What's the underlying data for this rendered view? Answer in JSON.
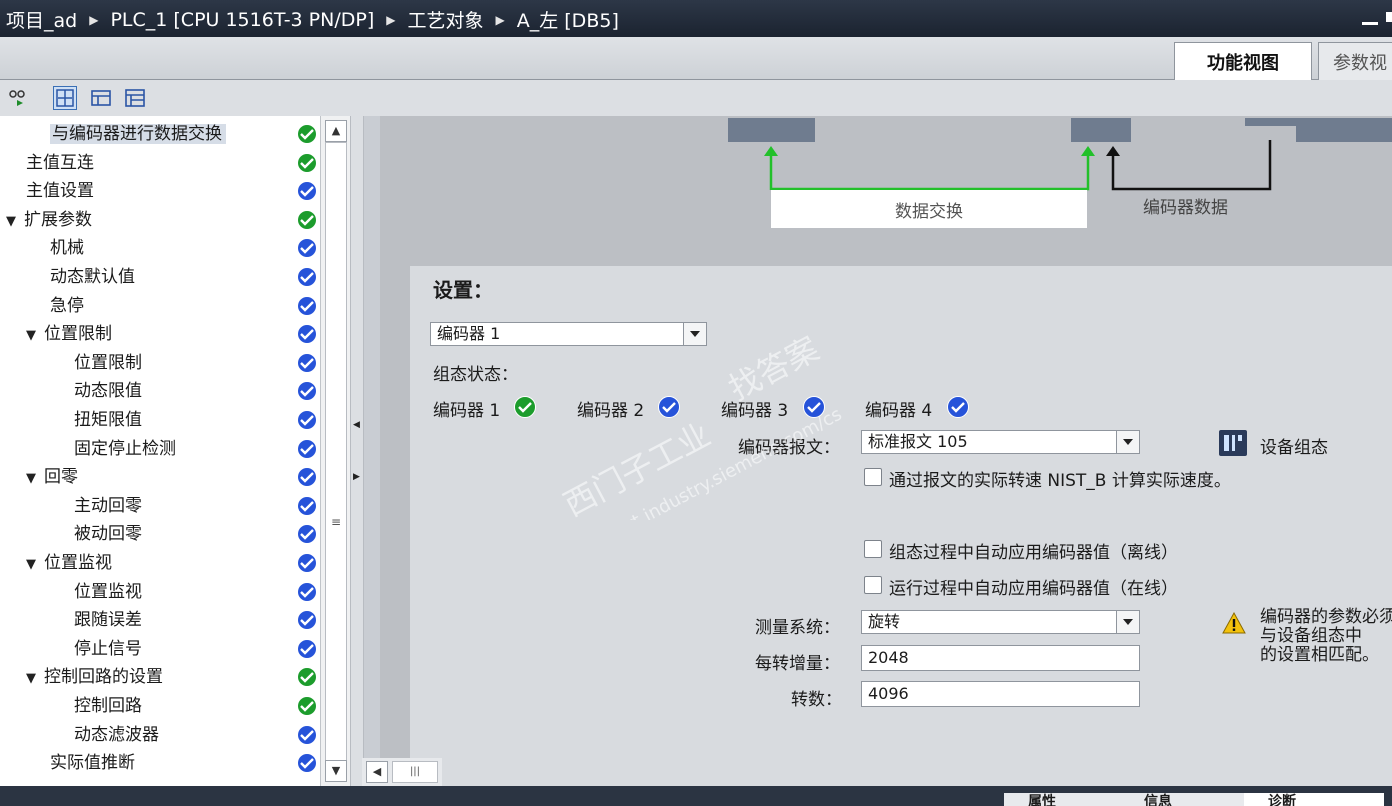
{
  "titlebar": {
    "crumbs": [
      "项目_ad",
      "PLC_1 [CPU 1516T-3 PN/DP]",
      "工艺对象",
      "A_左 [DB5]"
    ]
  },
  "view_tabs": {
    "function_view": "功能视图",
    "parameter_view": "参数视"
  },
  "nav": {
    "items": [
      {
        "label": "与编码器进行数据交换",
        "level": 2,
        "expander": "",
        "status": "green",
        "selected": true
      },
      {
        "label": "主值互连",
        "level": 1,
        "expander": "",
        "status": "green"
      },
      {
        "label": "主值设置",
        "level": 1,
        "expander": "",
        "status": "blue"
      },
      {
        "label": "扩展参数",
        "level": 0,
        "expander": "▼",
        "status": "green"
      },
      {
        "label": "机械",
        "level": 2,
        "expander": "",
        "status": "blue"
      },
      {
        "label": "动态默认值",
        "level": 2,
        "expander": "",
        "status": "blue"
      },
      {
        "label": "急停",
        "level": 2,
        "expander": "",
        "status": "blue"
      },
      {
        "label": "位置限制",
        "level": 1,
        "expander": "▼",
        "status": "blue"
      },
      {
        "label": "位置限制",
        "level": 3,
        "expander": "",
        "status": "blue"
      },
      {
        "label": "动态限值",
        "level": 3,
        "expander": "",
        "status": "blue"
      },
      {
        "label": "扭矩限值",
        "level": 3,
        "expander": "",
        "status": "blue"
      },
      {
        "label": "固定停止检测",
        "level": 3,
        "expander": "",
        "status": "blue"
      },
      {
        "label": "回零",
        "level": 1,
        "expander": "▼",
        "status": "blue"
      },
      {
        "label": "主动回零",
        "level": 3,
        "expander": "",
        "status": "blue"
      },
      {
        "label": "被动回零",
        "level": 3,
        "expander": "",
        "status": "blue"
      },
      {
        "label": "位置监视",
        "level": 1,
        "expander": "▼",
        "status": "blue"
      },
      {
        "label": "位置监视",
        "level": 3,
        "expander": "",
        "status": "blue"
      },
      {
        "label": "跟随误差",
        "level": 3,
        "expander": "",
        "status": "blue"
      },
      {
        "label": "停止信号",
        "level": 3,
        "expander": "",
        "status": "blue"
      },
      {
        "label": "控制回路的设置",
        "level": 1,
        "expander": "▼",
        "status": "green"
      },
      {
        "label": "控制回路",
        "level": 3,
        "expander": "",
        "status": "green"
      },
      {
        "label": "动态滤波器",
        "level": 3,
        "expander": "",
        "status": "blue"
      },
      {
        "label": "实际值推断",
        "level": 2,
        "expander": "",
        "status": "blue"
      }
    ]
  },
  "diagram": {
    "exchange_label": "数据交换",
    "encoder_data_label": "编码器数据"
  },
  "settings": {
    "title": "设置：",
    "encoder_select": "编码器 1",
    "config_status_label": "组态状态：",
    "encoders": [
      {
        "label": "编码器 1",
        "status": "green"
      },
      {
        "label": "编码器 2",
        "status": "blue"
      },
      {
        "label": "编码器 3",
        "status": "blue"
      },
      {
        "label": "编码器 4",
        "status": "blue"
      }
    ],
    "telegram_label": "编码器报文：",
    "telegram_value": "标准报文 105",
    "device_config_label": "设备组态",
    "nist_checkbox": "通过报文的实际转速 NIST_B 计算实际速度。",
    "offline_checkbox": "组态过程中自动应用编码器值（离线）",
    "online_checkbox": "运行过程中自动应用编码器值（在线）",
    "measuring_system_label": "测量系统：",
    "measuring_system_value": "旋转",
    "increments_label": "每转增量：",
    "increments_value": "2048",
    "revolutions_label": "转数：",
    "revolutions_value": "4096",
    "warning_lines": [
      "编码器的参数必须",
      "与设备组态中",
      "的设置相匹配。"
    ]
  },
  "watermark": {
    "line1": "西门子工业",
    "line2": "找答案",
    "line3": "support.industry.siemens.com/cs"
  },
  "bottom_tabs": [
    "属性",
    "信息",
    "诊断"
  ],
  "colors": {
    "status_green": "#1c9c2c",
    "status_blue": "#2653d9",
    "arrow_green": "#22c02a"
  }
}
